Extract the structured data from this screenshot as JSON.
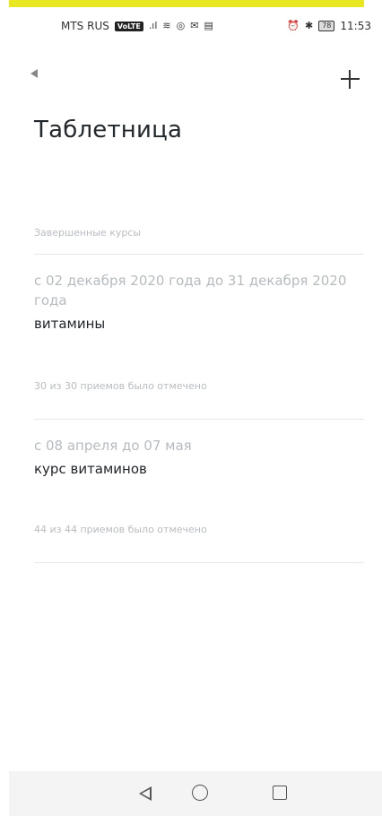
{
  "status_bar": {
    "carrier": "MTS RUS",
    "volte": "VoLTE",
    "battery": "78",
    "time": "11:53",
    "icons": [
      "signal-icon",
      "wifi-icon",
      "vpn-icon",
      "mail-icon",
      "message-icon",
      "alarm-icon",
      "bluetooth-icon",
      "battery-icon"
    ]
  },
  "header": {
    "back_icon": "back-arrow-icon",
    "add_icon": "plus-icon"
  },
  "page": {
    "title": "Таблетница",
    "section_label": "Завершенные курсы"
  },
  "courses": [
    {
      "dates": "с 02 декабря 2020 года до 31 декабря 2020 года",
      "name": "витамины",
      "stats": "30 из 30 приемов было отмечено"
    },
    {
      "dates": "с 08 апреля до 07 мая",
      "name": "курс витаминов",
      "stats": "44 из 44 приемов было отмечено"
    }
  ],
  "nav_bar": {
    "icons": [
      "nav-back-icon",
      "nav-home-icon",
      "nav-recents-icon"
    ]
  },
  "colors": {
    "accent_bar": "#e9e820",
    "title": "#23282d",
    "muted_text": "#b8bcc1",
    "divider": "#e6e8eb"
  }
}
